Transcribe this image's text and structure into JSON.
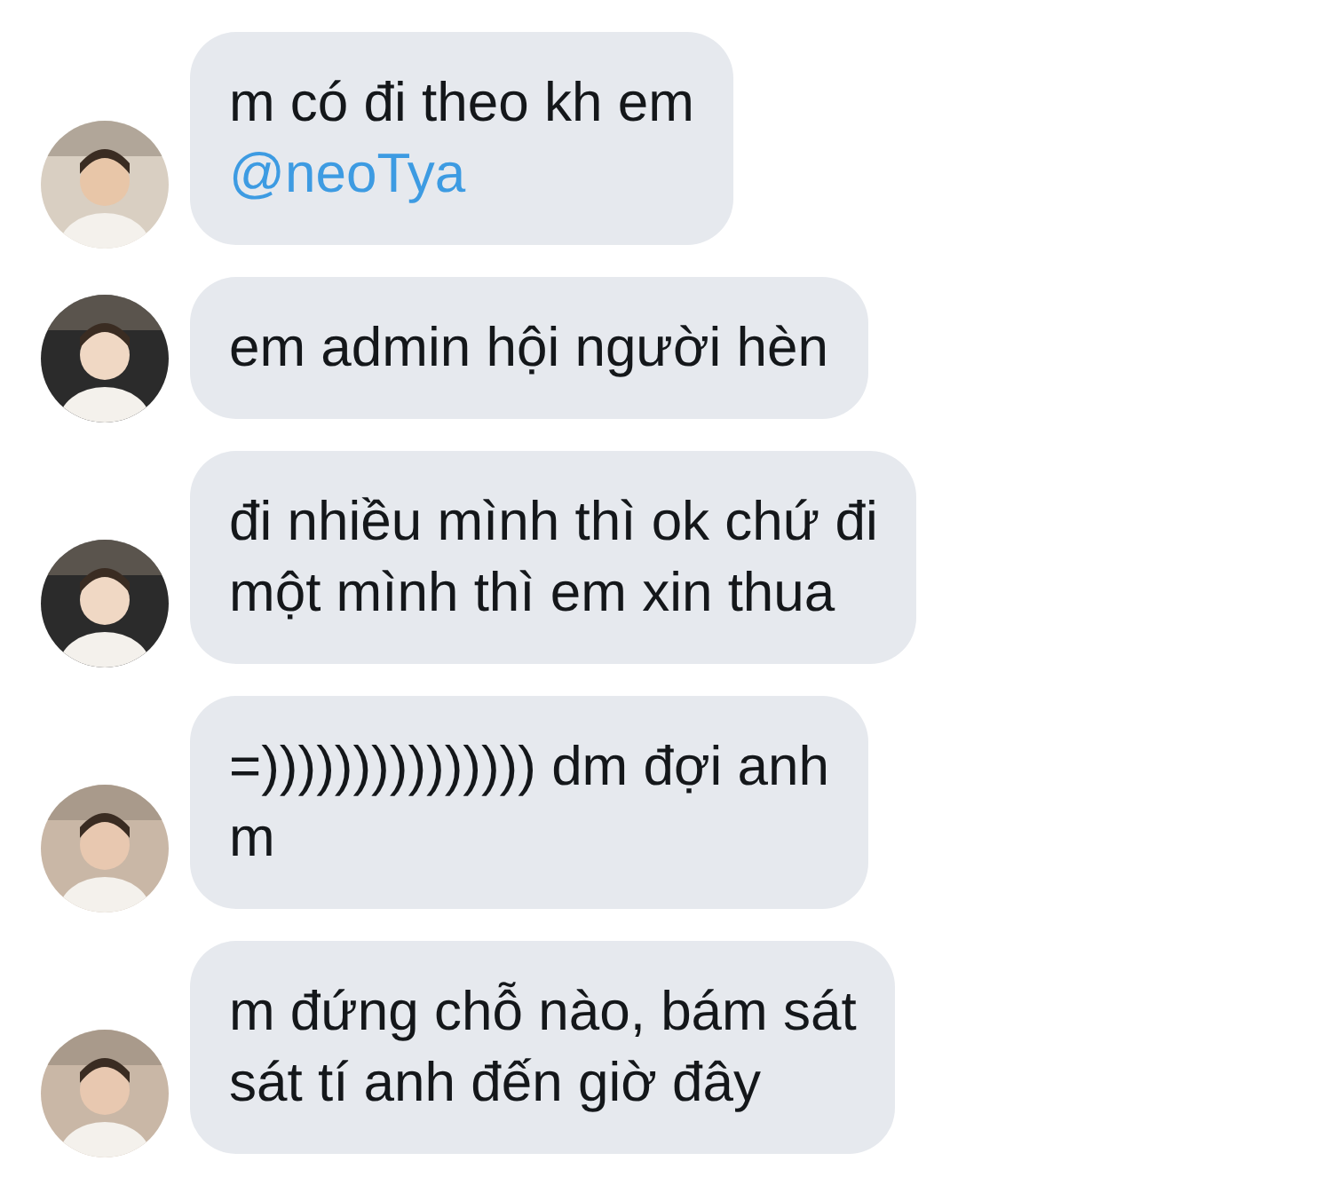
{
  "messages": [
    {
      "avatar": {
        "kind": "picture"
      },
      "lines": [
        "m có đi theo kh em"
      ],
      "mention": "@neoTya"
    },
    {
      "avatar": {
        "kind": "picture"
      },
      "lines": [
        "em admin hội người hèn"
      ]
    },
    {
      "avatar": {
        "kind": "picture"
      },
      "lines": [
        "đi nhiều mình thì ok chứ đi",
        "một mình thì em xin thua"
      ]
    },
    {
      "avatar": {
        "kind": "picture"
      },
      "lines": [
        "=))))))))))))))) dm đợi anh",
        "m"
      ]
    },
    {
      "avatar": {
        "kind": "picture"
      },
      "lines": [
        "m đứng chỗ nào, bám sát",
        "sát tí anh đến giờ đây"
      ]
    }
  ]
}
